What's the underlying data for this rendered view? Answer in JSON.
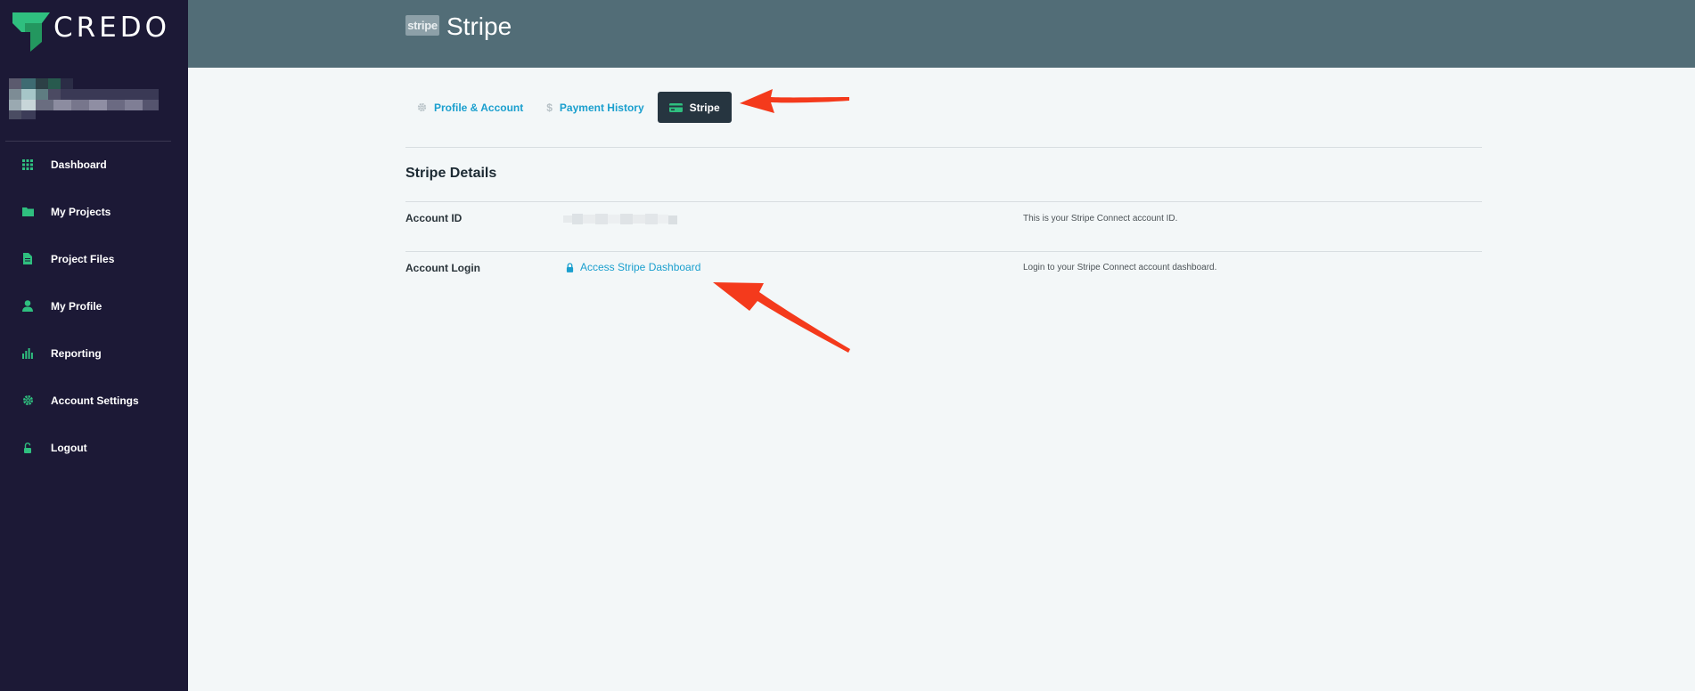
{
  "app": {
    "brand": "CREDO",
    "brand_color": "#2fbf7f",
    "sidebar_bg": "#1c1936",
    "header_bg": "#526d77",
    "link_color": "#1a9fce"
  },
  "sidebar": {
    "items": [
      {
        "label": "Dashboard",
        "icon": "grid-icon"
      },
      {
        "label": "My Projects",
        "icon": "folder-icon"
      },
      {
        "label": "Project Files",
        "icon": "file-icon"
      },
      {
        "label": "My Profile",
        "icon": "user-icon"
      },
      {
        "label": "Reporting",
        "icon": "bar-chart-icon"
      },
      {
        "label": "Account Settings",
        "icon": "gear-icon"
      },
      {
        "label": "Logout",
        "icon": "unlock-icon"
      }
    ]
  },
  "header": {
    "badge": "stripe",
    "title": "Stripe"
  },
  "tabs": [
    {
      "label": "Profile & Account",
      "icon": "gear-icon",
      "active": false
    },
    {
      "label": "Payment History",
      "icon": "dollar-icon",
      "active": false
    },
    {
      "label": "Stripe",
      "icon": "credit-card-icon",
      "active": true
    }
  ],
  "details": {
    "title": "Stripe Details",
    "account_id": {
      "label": "Account ID",
      "description": "This is your Stripe Connect account ID."
    },
    "account_login": {
      "label": "Account Login",
      "link": "Access Stripe Dashboard",
      "description": "Login to your Stripe Connect account dashboard."
    }
  },
  "annotations": {
    "arrow_color": "#f43a1c"
  }
}
